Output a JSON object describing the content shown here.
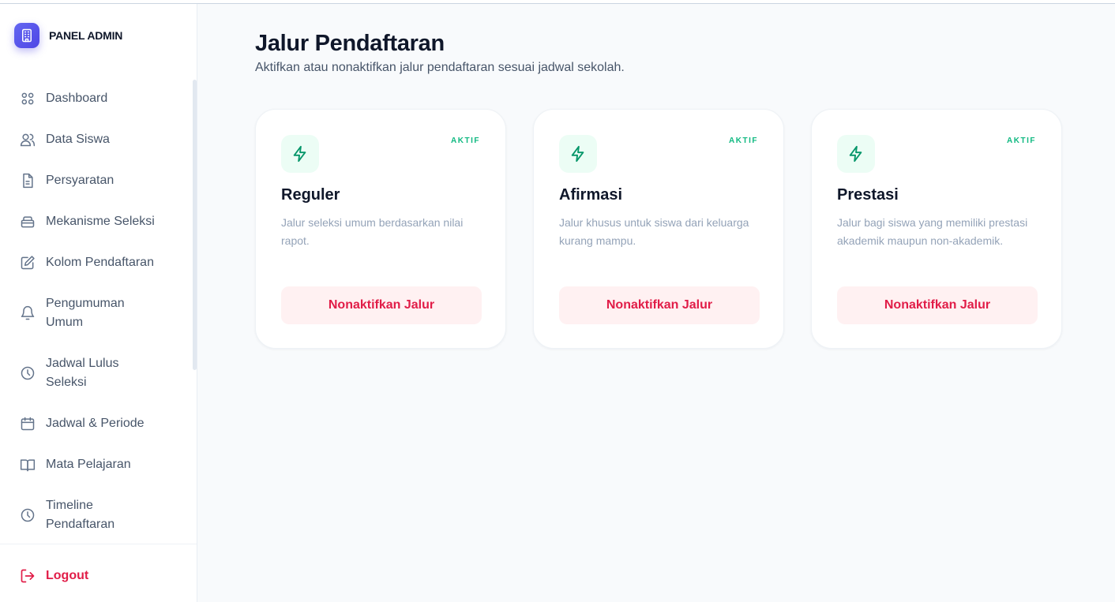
{
  "brand": {
    "title": "PANEL ADMIN",
    "icon": "building-icon",
    "color": "#4f46e5"
  },
  "sidebar": {
    "items": [
      {
        "label": "Dashboard",
        "icon": "grid-icon"
      },
      {
        "label": "Data Siswa",
        "icon": "users-icon"
      },
      {
        "label": "Persyaratan",
        "icon": "file-icon"
      },
      {
        "label": "Mekanisme Seleksi",
        "icon": "layers-icon"
      },
      {
        "label": "Kolom Pendaftaran",
        "icon": "edit-icon"
      },
      {
        "label": "Pengumuman\nUmum",
        "icon": "bell-icon"
      },
      {
        "label": "Jadwal Lulus\nSeleksi",
        "icon": "clock-icon"
      },
      {
        "label": "Jadwal & Periode",
        "icon": "calendar-icon"
      },
      {
        "label": "Mata Pelajaran",
        "icon": "book-icon"
      },
      {
        "label": "Timeline\nPendaftaran",
        "icon": "clock-icon"
      }
    ],
    "logout": {
      "label": "Logout",
      "icon": "logout-icon",
      "color": "#e11d48"
    }
  },
  "main": {
    "title": "Jalur Pendaftaran",
    "subtitle": "Aktifkan atau nonaktifkan jalur pendaftaran sesuai jadwal sekolah.",
    "cards": [
      {
        "title": "Reguler",
        "status": "AKTIF",
        "description": "Jalur seleksi umum berdasarkan nilai rapot.",
        "button": "Nonaktifkan Jalur",
        "icon": "zap-icon"
      },
      {
        "title": "Afirmasi",
        "status": "AKTIF",
        "description": "Jalur khusus untuk siswa dari keluarga kurang mampu.",
        "button": "Nonaktifkan Jalur",
        "icon": "zap-icon"
      },
      {
        "title": "Prestasi",
        "status": "AKTIF",
        "description": "Jalur bagi siswa yang memiliki prestasi akademik maupun non-akademik.",
        "button": "Nonaktifkan Jalur",
        "icon": "zap-icon"
      }
    ]
  },
  "colors": {
    "accent": "#4f46e5",
    "active": "#10b981",
    "danger": "#e11d48"
  }
}
